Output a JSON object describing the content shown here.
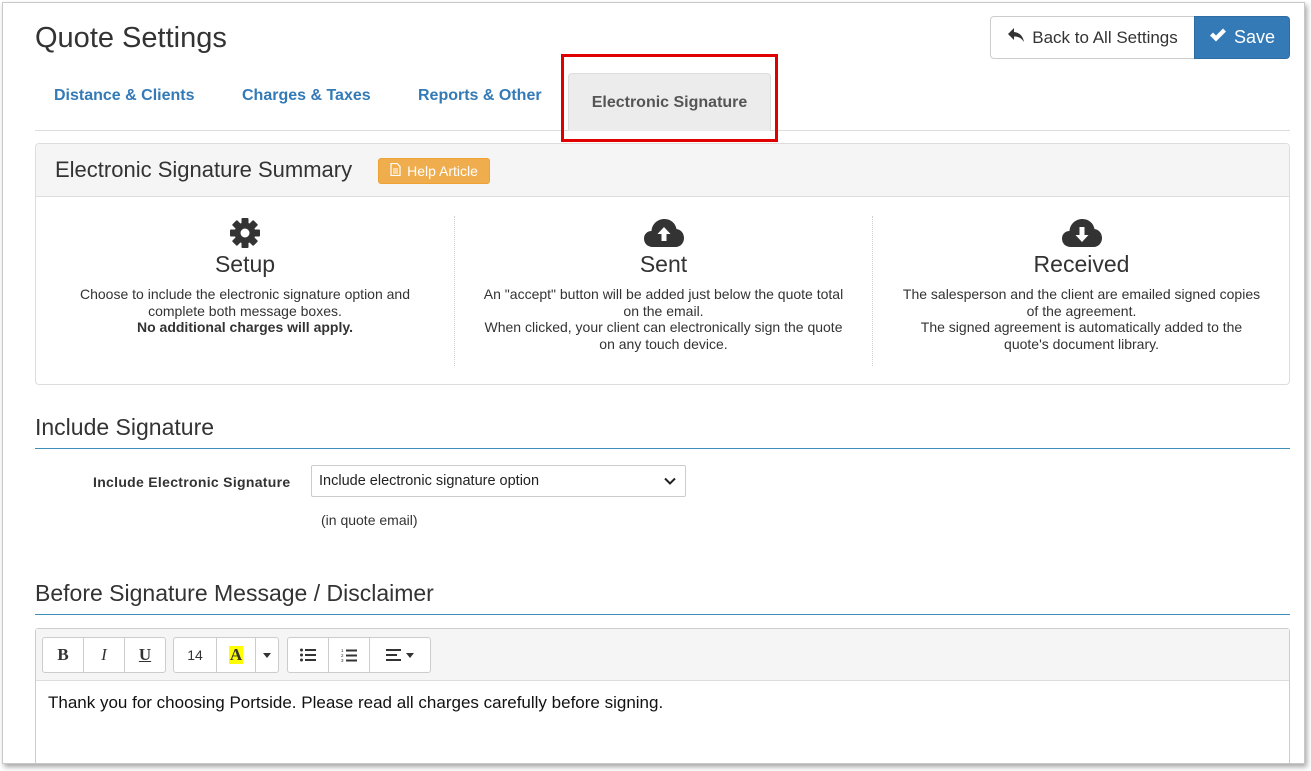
{
  "header": {
    "title": "Quote Settings",
    "back_label": "Back to All Settings",
    "save_label": "Save"
  },
  "tabs": [
    {
      "label": "Distance & Clients"
    },
    {
      "label": "Charges & Taxes"
    },
    {
      "label": "Reports & Other"
    },
    {
      "label": "Electronic Signature",
      "active": true
    }
  ],
  "summary": {
    "title": "Electronic Signature Summary",
    "help_label": "Help Article",
    "columns": [
      {
        "icon": "gear-icon",
        "title": "Setup",
        "line1": "Choose to include the electronic signature option and complete both message boxes.",
        "line2": "No additional charges will apply."
      },
      {
        "icon": "cloud-upload-icon",
        "title": "Sent",
        "line1": "An \"accept\" button will be added just below the quote total on the email.",
        "line2": "When clicked, your client can electronically sign the quote on any touch device."
      },
      {
        "icon": "cloud-download-icon",
        "title": "Received",
        "line1": "The salesperson and the client are emailed signed copies of the agreement.",
        "line2": "The signed agreement is automatically added to the quote's document library."
      }
    ]
  },
  "include_signature": {
    "section_title": "Include Signature",
    "field_label": "Include Electronic Signature",
    "selected_option": "Include electronic signature option",
    "hint": "(in quote email)"
  },
  "disclaimer": {
    "section_title": "Before Signature Message / Disclaimer",
    "font_size": "14",
    "content": "Thank you for choosing Portside. Please read all charges carefully before signing."
  },
  "colors": {
    "link": "#337ab7",
    "primary": "#337ab7",
    "warning": "#f0ad4e",
    "highlight": "#e00000"
  }
}
